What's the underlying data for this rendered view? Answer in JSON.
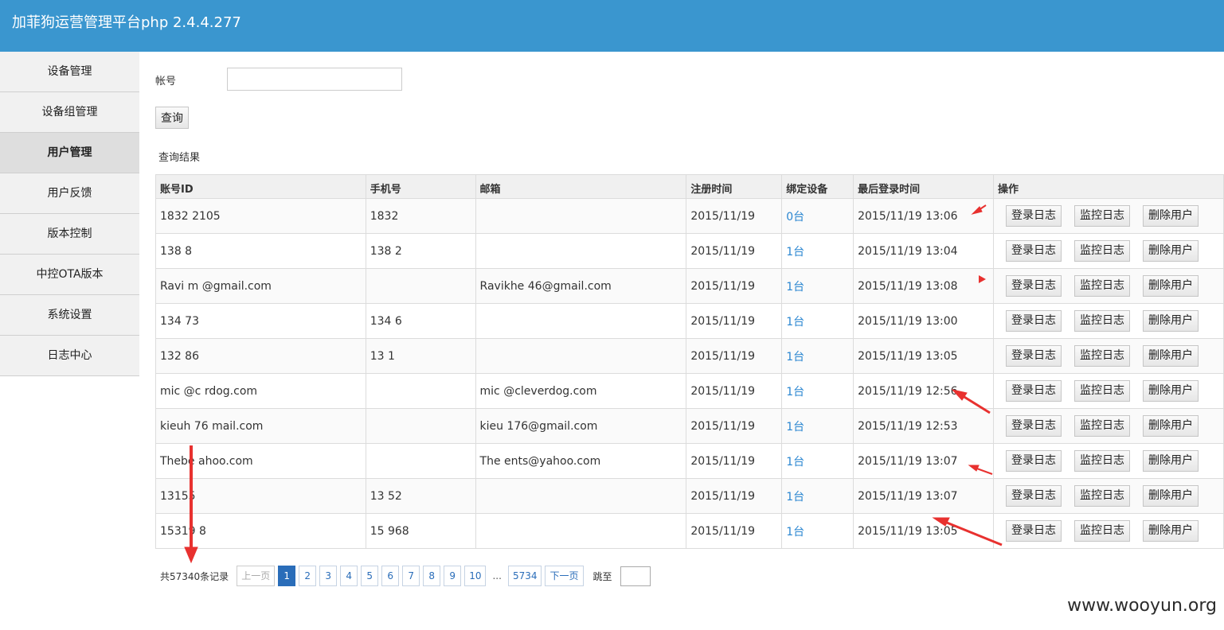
{
  "header": {
    "title": "加菲狗运营管理平台php 2.4.4.277"
  },
  "sidebar": {
    "items": [
      {
        "label": "设备管理"
      },
      {
        "label": "设备组管理"
      },
      {
        "label": "用户管理",
        "active": true
      },
      {
        "label": "用户反馈"
      },
      {
        "label": "版本控制"
      },
      {
        "label": "中控OTA版本"
      },
      {
        "label": "系统设置"
      },
      {
        "label": "日志中心"
      }
    ]
  },
  "search": {
    "label": "帐号",
    "value": "",
    "button": "查询"
  },
  "results": {
    "title": "查询结果",
    "columns": [
      "账号ID",
      "手机号",
      "邮箱",
      "注册时间",
      "绑定设备",
      "最后登录时间",
      "操作"
    ],
    "rows": [
      {
        "account": "1832 2105",
        "phone": "1832",
        "email": "",
        "registered": "2015/11/19",
        "devices": "0台",
        "last_login": "2015/11/19 13:06"
      },
      {
        "account": "138 8",
        "phone": "138 2",
        "email": "",
        "registered": "2015/11/19",
        "devices": "1台",
        "last_login": "2015/11/19 13:04"
      },
      {
        "account": "Ravi m @gmail.com",
        "phone": "",
        "email": "Ravikhe 46@gmail.com",
        "registered": "2015/11/19",
        "devices": "1台",
        "last_login": "2015/11/19 13:08"
      },
      {
        "account": "134 73",
        "phone": "134 6",
        "email": "",
        "registered": "2015/11/19",
        "devices": "1台",
        "last_login": "2015/11/19 13:00"
      },
      {
        "account": "132 86",
        "phone": "13 1",
        "email": "",
        "registered": "2015/11/19",
        "devices": "1台",
        "last_login": "2015/11/19 13:05"
      },
      {
        "account": "mic @c rdog.com",
        "phone": "",
        "email": "mic @cleverdog.com",
        "registered": "2015/11/19",
        "devices": "1台",
        "last_login": "2015/11/19 12:56"
      },
      {
        "account": "kieuh 76 mail.com",
        "phone": "",
        "email": "kieu 176@gmail.com",
        "registered": "2015/11/19",
        "devices": "1台",
        "last_login": "2015/11/19 12:53"
      },
      {
        "account": "Thebe ahoo.com",
        "phone": "",
        "email": "The ents@yahoo.com",
        "registered": "2015/11/19",
        "devices": "1台",
        "last_login": "2015/11/19 13:07"
      },
      {
        "account": "13155",
        "phone": "13 52",
        "email": "",
        "registered": "2015/11/19",
        "devices": "1台",
        "last_login": "2015/11/19 13:07"
      },
      {
        "account": "15319 8",
        "phone": "15 968",
        "email": "",
        "registered": "2015/11/19",
        "devices": "1台",
        "last_login": "2015/11/19 13:05"
      }
    ],
    "actions": {
      "login_log": "登录日志",
      "monitor_log": "监控日志",
      "delete_user": "删除用户"
    }
  },
  "pager": {
    "total": "共57340条记录",
    "prev": "上一页",
    "pages": [
      "1",
      "2",
      "3",
      "4",
      "5",
      "6",
      "7",
      "8",
      "9",
      "10"
    ],
    "current_page": "1",
    "ellipsis": "...",
    "last": "5734",
    "next": "下一页",
    "jump": "跳至"
  },
  "watermark": "www.wooyun.org",
  "colors": {
    "header": "#3a96cf",
    "link": "#2a86d1",
    "annotation": "#e8312f"
  }
}
